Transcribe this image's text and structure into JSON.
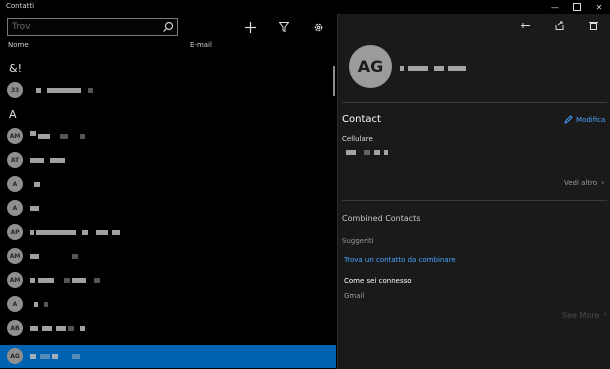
{
  "window": {
    "title": "Contatti"
  },
  "search": {
    "placeholder": "Trov"
  },
  "columns": {
    "name": "Nome",
    "email": "E-mail"
  },
  "list": {
    "sections": [
      "&!",
      "A"
    ],
    "rows": [
      {
        "initials": "33"
      },
      {
        "initials": "AM"
      },
      {
        "initials": "AT"
      },
      {
        "initials": "A"
      },
      {
        "initials": "A"
      },
      {
        "initials": "AP"
      },
      {
        "initials": "AM"
      },
      {
        "initials": "AM"
      },
      {
        "initials": "A"
      },
      {
        "initials": "AB"
      },
      {
        "initials": "AG"
      }
    ]
  },
  "detail": {
    "avatar_initials": "AG",
    "contact_heading": "Contact",
    "edit_label": "Modifica",
    "phone_label": "Cellulare",
    "see_more_1": "Vedi altro",
    "combined_heading": "Combined Contacts",
    "suggestions_label": "Suggeriti",
    "find_contact_link": "Trova un contatto da combinare",
    "connected_label": "Come sei connesso",
    "connected_source": "Gmail",
    "see_more_2": "See More"
  },
  "colors": {
    "accent": "#0063b1",
    "link": "#4aa3ff"
  }
}
